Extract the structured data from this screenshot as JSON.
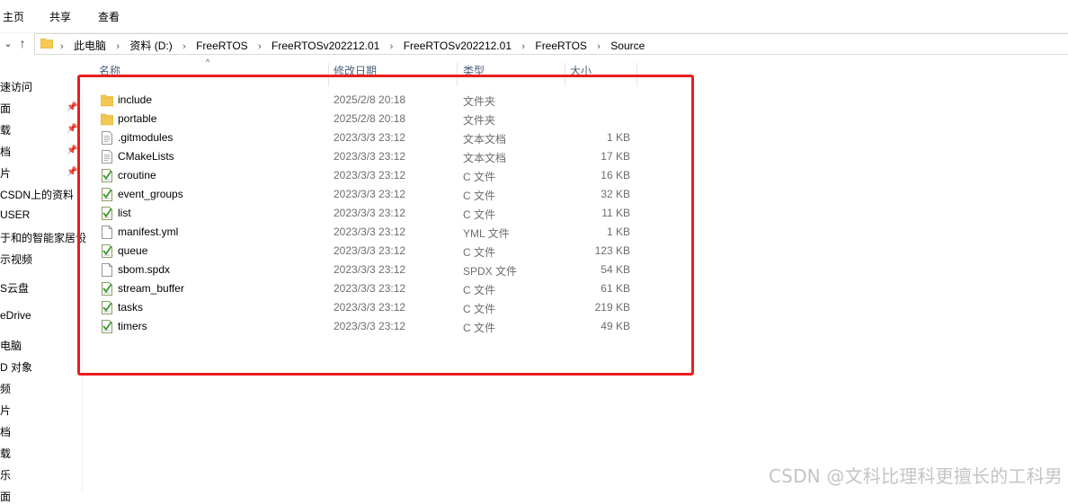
{
  "ribbon": {
    "tabs": [
      "主页",
      "共享",
      "查看"
    ]
  },
  "address": {
    "crumbs": [
      "此电脑",
      "资料 (D:)",
      "FreeRTOS",
      "FreeRTOSv202212.01",
      "FreeRTOSv202212.01",
      "FreeRTOS",
      "Source"
    ]
  },
  "navpane": {
    "items": [
      "速访问",
      "面",
      "载",
      "档",
      "片",
      "CSDN上的资料",
      "USER",
      "于和的智能家居设",
      "示视频",
      "S云盘",
      "eDrive",
      "电脑",
      "D 对象",
      "频",
      "片",
      "档",
      "载",
      "乐",
      "面"
    ]
  },
  "columns": {
    "name": "名称",
    "modified": "修改日期",
    "type": "类型",
    "size": "大小"
  },
  "files": [
    {
      "name": "include",
      "date": "2025/2/8 20:18",
      "type": "文件夹",
      "size": "",
      "icon": "folder-icon"
    },
    {
      "name": "portable",
      "date": "2025/2/8 20:18",
      "type": "文件夹",
      "size": "",
      "icon": "folder-icon"
    },
    {
      "name": ".gitmodules",
      "date": "2023/3/3 23:12",
      "type": "文本文档",
      "size": "1 KB",
      "icon": "document-icon"
    },
    {
      "name": "CMakeLists",
      "date": "2023/3/3 23:12",
      "type": "文本文档",
      "size": "17 KB",
      "icon": "document-icon"
    },
    {
      "name": "croutine",
      "date": "2023/3/3 23:12",
      "type": "C 文件",
      "size": "16 KB",
      "icon": "c-file-icon"
    },
    {
      "name": "event_groups",
      "date": "2023/3/3 23:12",
      "type": "C 文件",
      "size": "32 KB",
      "icon": "c-file-icon"
    },
    {
      "name": "list",
      "date": "2023/3/3 23:12",
      "type": "C 文件",
      "size": "11 KB",
      "icon": "c-file-icon"
    },
    {
      "name": "manifest.yml",
      "date": "2023/3/3 23:12",
      "type": "YML 文件",
      "size": "1 KB",
      "icon": "blank-file-icon"
    },
    {
      "name": "queue",
      "date": "2023/3/3 23:12",
      "type": "C 文件",
      "size": "123 KB",
      "icon": "c-file-icon"
    },
    {
      "name": "sbom.spdx",
      "date": "2023/3/3 23:12",
      "type": "SPDX 文件",
      "size": "54 KB",
      "icon": "blank-file-icon"
    },
    {
      "name": "stream_buffer",
      "date": "2023/3/3 23:12",
      "type": "C 文件",
      "size": "61 KB",
      "icon": "c-file-icon"
    },
    {
      "name": "tasks",
      "date": "2023/3/3 23:12",
      "type": "C 文件",
      "size": "219 KB",
      "icon": "c-file-icon"
    },
    {
      "name": "timers",
      "date": "2023/3/3 23:12",
      "type": "C 文件",
      "size": "49 KB",
      "icon": "c-file-icon"
    }
  ],
  "watermark": "CSDN @文科比理科更擅长的工科男",
  "colors": {
    "highlight": "#e81e1e",
    "folder": "#f5c951",
    "header_text": "#4c607a"
  }
}
